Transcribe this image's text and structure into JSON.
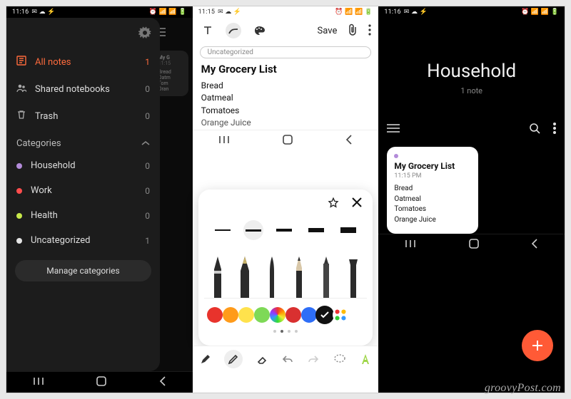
{
  "statusbar": {
    "time1": "11:16",
    "time2": "11:15",
    "time3": "11:16"
  },
  "phone1": {
    "gear": "settings",
    "nav": [
      {
        "icon": "all-notes-icon",
        "label": "All notes",
        "count": "1",
        "accent": true
      },
      {
        "icon": "shared-icon",
        "label": "Shared notebooks",
        "count": "0"
      },
      {
        "icon": "trash-icon",
        "label": "Trash",
        "count": "0"
      }
    ],
    "categories_label": "Categories",
    "categories": [
      {
        "color": "#b38bd9",
        "label": "Household",
        "count": "0"
      },
      {
        "color": "#ff4d4d",
        "label": "Work",
        "count": "0"
      },
      {
        "color": "#c7e84a",
        "label": "Health",
        "count": "0"
      },
      {
        "color": "#e4e4e4",
        "label": "Uncategorized",
        "count": "1"
      }
    ],
    "manage_label": "Manage categories",
    "bg_card": {
      "title": "My G",
      "time": "11:15",
      "lines": [
        "Bread",
        "Oatm",
        "Tom",
        "Oran"
      ]
    }
  },
  "phone2": {
    "save_label": "Save",
    "chip_label": "Uncategorized",
    "doc_title": "My Grocery List",
    "doc_lines": [
      "Bread",
      "Oatmeal",
      "Tomatoes",
      "Orange Juice"
    ],
    "strokes_selected_index": 1,
    "colors_row1": [
      "#e8332c",
      "#ff9b1a",
      "#ffe24c",
      "#7ed957",
      "multi"
    ],
    "colors_row2": [
      "#d93030",
      "#2e6ef7",
      "#111111",
      "checked",
      "dots"
    ]
  },
  "phone3": {
    "header_title": "Household",
    "header_sub": "1 note",
    "card": {
      "title": "My Grocery List",
      "time": "11:15 PM",
      "lines": [
        "Bread",
        "Oatmeal",
        "Tomatoes",
        "Orange Juice"
      ]
    }
  },
  "watermark": "groovyPost.com"
}
